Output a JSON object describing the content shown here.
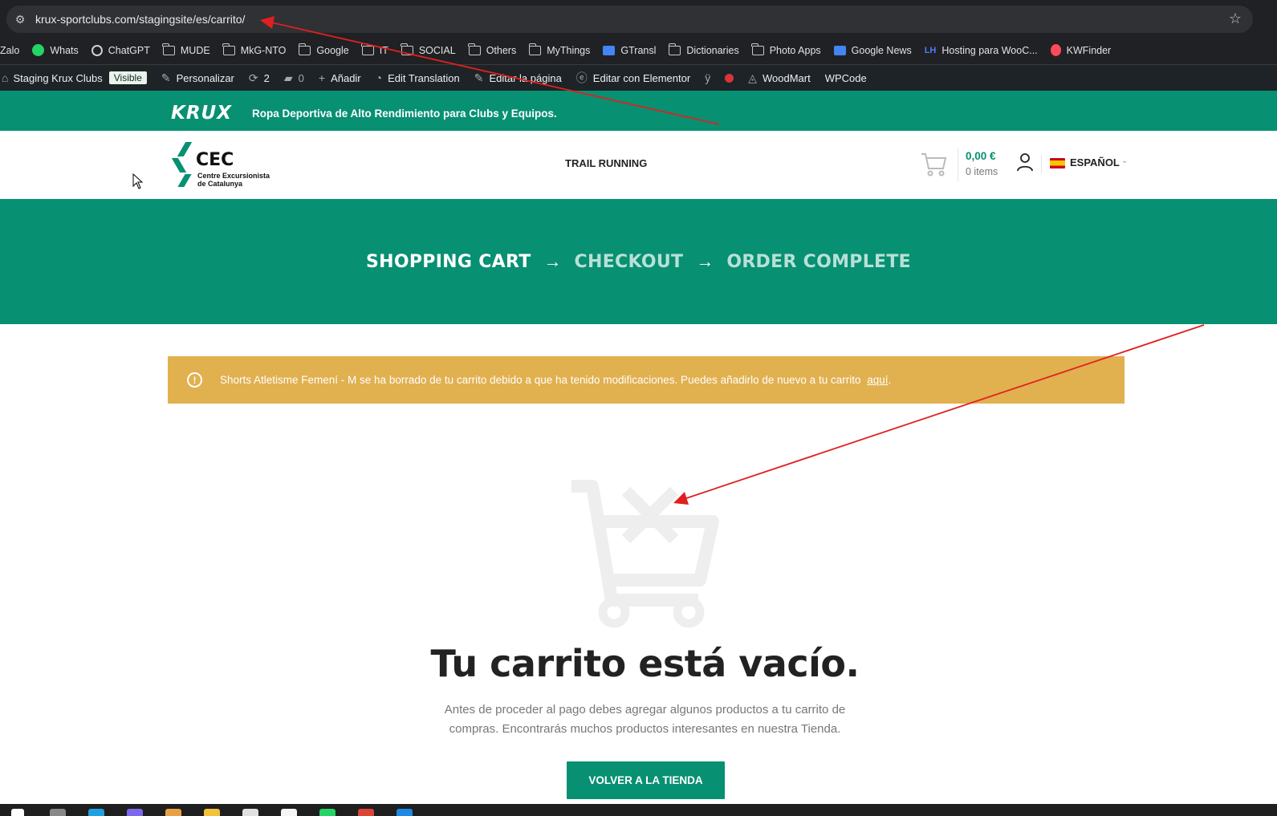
{
  "browser": {
    "url": "krux-sportclubs.com/stagingsite/es/carrito/",
    "bookmarks": [
      {
        "label": "Zalo",
        "icon": "none"
      },
      {
        "label": "Whats",
        "icon": "whatsapp-icon"
      },
      {
        "label": "ChatGPT",
        "icon": "chatgpt-icon"
      },
      {
        "label": "MUDE",
        "icon": "folder-icon"
      },
      {
        "label": "MkG-NTO",
        "icon": "folder-icon"
      },
      {
        "label": "Google",
        "icon": "folder-icon"
      },
      {
        "label": "IT",
        "icon": "folder-icon"
      },
      {
        "label": "SOCIAL",
        "icon": "folder-icon"
      },
      {
        "label": "Others",
        "icon": "folder-icon"
      },
      {
        "label": "MyThings",
        "icon": "folder-icon"
      },
      {
        "label": "GTransl",
        "icon": "translate-icon"
      },
      {
        "label": "Dictionaries",
        "icon": "folder-icon"
      },
      {
        "label": "Photo Apps",
        "icon": "folder-icon"
      },
      {
        "label": "Google News",
        "icon": "news-icon"
      },
      {
        "label": "Hosting para WooC...",
        "icon": "lh-icon"
      },
      {
        "label": "KWFinder",
        "icon": "kwfinder-icon"
      }
    ]
  },
  "wp_bar": {
    "site_name": "Staging Krux Clubs",
    "visible_badge": "Visible",
    "customize": "Personalizar",
    "updates_count": "2",
    "comments_count": "0",
    "add_new": "Añadir",
    "edit_translation": "Edit Translation",
    "edit_page": "Editar la página",
    "edit_elementor": "Editar con Elementor",
    "woodmart": "WoodMart",
    "wpcode": "WPCode"
  },
  "topbar": {
    "logo_text": "KRUX",
    "tagline": "Ropa Deportiva de Alto Rendimiento para Clubs y Equipos."
  },
  "header": {
    "logo_big": "CEC",
    "logo_line1": "Centre Excursionista",
    "logo_line2": "de Catalunya",
    "nav_item": "TRAIL RUNNING",
    "cart_total": "0,00 €",
    "cart_items": "0 items",
    "language": "ESPAÑOL"
  },
  "steps": [
    {
      "label": "SHOPPING CART",
      "active": true
    },
    {
      "label": "CHECKOUT",
      "active": false
    },
    {
      "label": "ORDER COMPLETE",
      "active": false
    }
  ],
  "notice": {
    "message": "Shorts Atletisme Femení - M se ha borrado de tu carrito debido a que ha tenido modificaciones. Puedes añadirlo de nuevo a tu carrito",
    "link_text": "aquí",
    "trailing": "."
  },
  "empty_cart": {
    "title": "Tu carrito está vacío.",
    "description": "Antes de proceder al pago debes agregar algunos productos a tu carrito de compras. Encontrarás muchos productos interesantes en nuestra Tienda.",
    "button_label": "VOLVER A LA TIENDA"
  },
  "colors": {
    "brand_green": "#079072",
    "notice_yellow": "#e1b04f",
    "annotation_red": "#e02020"
  }
}
